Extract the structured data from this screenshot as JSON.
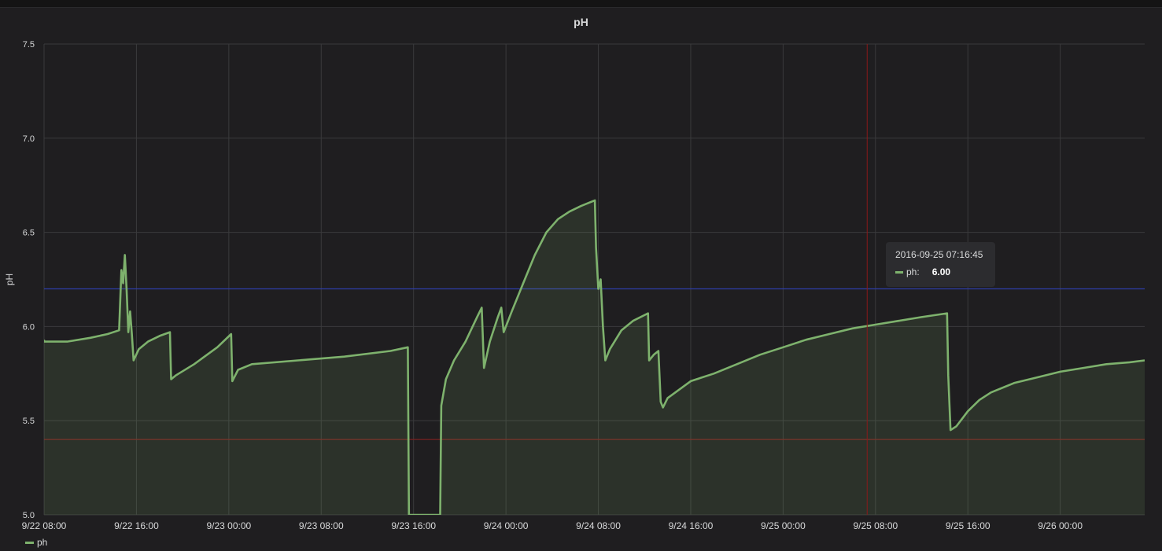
{
  "panel": {
    "title": "pH"
  },
  "chart_data": {
    "type": "area",
    "title": "pH",
    "ylabel": "pH",
    "xlabel": "",
    "ylim": [
      5.0,
      7.5
    ],
    "y_ticks": [
      "5.0",
      "5.5",
      "6.0",
      "6.5",
      "7.0",
      "7.5"
    ],
    "x_range_hours": [
      0,
      119
    ],
    "x_ticks": [
      {
        "label": "9/22 08:00",
        "hour": 0
      },
      {
        "label": "9/22 16:00",
        "hour": 8
      },
      {
        "label": "9/23 00:00",
        "hour": 16
      },
      {
        "label": "9/23 08:00",
        "hour": 24
      },
      {
        "label": "9/23 16:00",
        "hour": 32
      },
      {
        "label": "9/24 00:00",
        "hour": 40
      },
      {
        "label": "9/24 08:00",
        "hour": 48
      },
      {
        "label": "9/24 16:00",
        "hour": 56
      },
      {
        "label": "9/25 00:00",
        "hour": 64
      },
      {
        "label": "9/25 08:00",
        "hour": 72
      },
      {
        "label": "9/25 16:00",
        "hour": 80
      },
      {
        "label": "9/26 00:00",
        "hour": 88
      }
    ],
    "thresholds": [
      {
        "value": 6.2,
        "color": "#2f3da8"
      },
      {
        "value": 5.4,
        "color": "#7a2020"
      }
    ],
    "crosshair_hour": 71.28,
    "series": [
      {
        "name": "ph",
        "color": "#7eb26d",
        "points": [
          [
            -0.5,
            5.93
          ],
          [
            0,
            5.92
          ],
          [
            2,
            5.92
          ],
          [
            4,
            5.94
          ],
          [
            5.5,
            5.96
          ],
          [
            6.5,
            5.98
          ],
          [
            6.7,
            6.3
          ],
          [
            6.85,
            6.23
          ],
          [
            7.0,
            6.38
          ],
          [
            7.15,
            6.2
          ],
          [
            7.3,
            5.97
          ],
          [
            7.45,
            6.08
          ],
          [
            7.6,
            5.96
          ],
          [
            7.75,
            5.82
          ],
          [
            8.2,
            5.88
          ],
          [
            9,
            5.92
          ],
          [
            10,
            5.95
          ],
          [
            10.9,
            5.97
          ],
          [
            11.0,
            5.72
          ],
          [
            11.4,
            5.74
          ],
          [
            13,
            5.8
          ],
          [
            15,
            5.89
          ],
          [
            16.2,
            5.96
          ],
          [
            16.3,
            5.71
          ],
          [
            16.8,
            5.77
          ],
          [
            18,
            5.8
          ],
          [
            22,
            5.82
          ],
          [
            26,
            5.84
          ],
          [
            30,
            5.87
          ],
          [
            31.5,
            5.89
          ],
          [
            31.6,
            4.9
          ],
          [
            34.3,
            4.9
          ],
          [
            34.4,
            5.58
          ],
          [
            34.8,
            5.72
          ],
          [
            35.5,
            5.82
          ],
          [
            36.5,
            5.92
          ],
          [
            37.5,
            6.05
          ],
          [
            37.9,
            6.1
          ],
          [
            38.1,
            5.78
          ],
          [
            38.6,
            5.92
          ],
          [
            39.3,
            6.05
          ],
          [
            39.6,
            6.1
          ],
          [
            39.8,
            5.97
          ],
          [
            40.5,
            6.08
          ],
          [
            41.5,
            6.23
          ],
          [
            42.5,
            6.38
          ],
          [
            43.5,
            6.5
          ],
          [
            44.5,
            6.57
          ],
          [
            45.5,
            6.61
          ],
          [
            46.5,
            6.64
          ],
          [
            47.7,
            6.67
          ],
          [
            47.8,
            6.42
          ],
          [
            48.0,
            6.2
          ],
          [
            48.2,
            6.25
          ],
          [
            48.4,
            6.0
          ],
          [
            48.6,
            5.82
          ],
          [
            49,
            5.88
          ],
          [
            50,
            5.98
          ],
          [
            51,
            6.03
          ],
          [
            52.3,
            6.07
          ],
          [
            52.4,
            5.82
          ],
          [
            52.8,
            5.85
          ],
          [
            53.2,
            5.87
          ],
          [
            53.4,
            5.6
          ],
          [
            53.6,
            5.57
          ],
          [
            54,
            5.62
          ],
          [
            56,
            5.71
          ],
          [
            58,
            5.75
          ],
          [
            60,
            5.8
          ],
          [
            62,
            5.85
          ],
          [
            64,
            5.89
          ],
          [
            66,
            5.93
          ],
          [
            68,
            5.96
          ],
          [
            70,
            5.99
          ],
          [
            72,
            6.01
          ],
          [
            74,
            6.03
          ],
          [
            76,
            6.05
          ],
          [
            78.2,
            6.07
          ],
          [
            78.3,
            5.74
          ],
          [
            78.5,
            5.45
          ],
          [
            79,
            5.47
          ],
          [
            80,
            5.55
          ],
          [
            81,
            5.61
          ],
          [
            82,
            5.65
          ],
          [
            84,
            5.7
          ],
          [
            86,
            5.73
          ],
          [
            88,
            5.76
          ],
          [
            90,
            5.78
          ],
          [
            92,
            5.8
          ],
          [
            94,
            5.81
          ],
          [
            95.4,
            5.82
          ]
        ]
      }
    ]
  },
  "tooltip": {
    "time": "2016-09-25 07:16:45",
    "series_label": "ph:",
    "value": "6.00"
  },
  "legend": {
    "items": [
      {
        "name": "ph",
        "color": "#7eb26d"
      }
    ]
  }
}
